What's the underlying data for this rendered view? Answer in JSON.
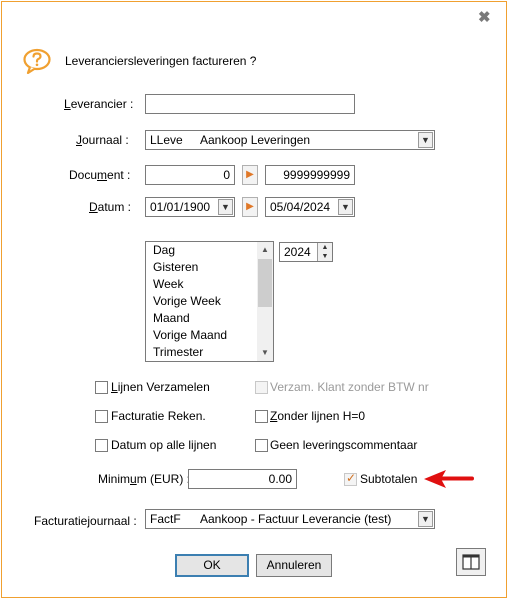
{
  "dialog": {
    "question": "Leveranciersleveringen factureren ?",
    "close_glyph": "✖",
    "question_icon": "question-bubble-icon"
  },
  "leverancier": {
    "label_pre": "",
    "label_ul": "L",
    "label_post": "everancier :",
    "value": ""
  },
  "journaal": {
    "label_pre": "",
    "label_ul": "J",
    "label_post": "ournaal :",
    "code": "LLeve",
    "name": "Aankoop Leveringen"
  },
  "document": {
    "label_pre": "Docu",
    "label_ul": "m",
    "label_post": "ent :",
    "from": "0",
    "to": "9999999999"
  },
  "datum": {
    "label_pre": "",
    "label_ul": "D",
    "label_post": "atum :",
    "from": "01/01/1900",
    "to": "05/04/2024"
  },
  "period_list": {
    "items": [
      "Dag",
      "Gisteren",
      "Week",
      "Vorige Week",
      "Maand",
      "Vorige Maand",
      "Trimester"
    ]
  },
  "year": "2024",
  "options": {
    "lijnen_verzamelen": {
      "ul": "L",
      "rest": "ijnen Verzamelen",
      "checked": false
    },
    "verzam_klant": {
      "label": "Verzam. Klant zonder BTW nr",
      "checked": false,
      "disabled": true
    },
    "facturatie_reken": {
      "label": "Facturatie Reken.",
      "checked": false
    },
    "zonder_lijnen": {
      "ul": "Z",
      "rest": "onder lijnen H=0",
      "checked": false
    },
    "datum_op_alle": {
      "label": "Datum op alle lijnen",
      "checked": false
    },
    "geen_commentaar": {
      "label": "Geen leveringscommentaar",
      "checked": false
    },
    "subtotalen": {
      "label": "Subtotalen",
      "checked": true
    }
  },
  "minimum": {
    "label_pre": "Minim",
    "label_ul": "u",
    "label_post": "m (EUR) :",
    "value": "0.00"
  },
  "facturatiejournaal": {
    "label": "Facturatiejournaal :",
    "code": "FactF",
    "name": "Aankoop - Factuur Leverancie (test)"
  },
  "buttons": {
    "ok": "OK",
    "cancel": "Annuleren"
  },
  "colors": {
    "accent_orange": "#f0a030",
    "arrow_red": "#e01010",
    "default_button_border": "#3c7fb1"
  }
}
